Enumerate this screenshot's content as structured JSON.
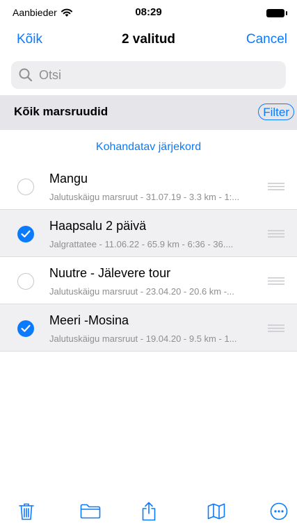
{
  "status": {
    "carrier": "Aanbieder",
    "time": "08:29"
  },
  "nav": {
    "left_label": "Kõik",
    "title": "2 valitud",
    "right_label": "Cancel"
  },
  "search": {
    "placeholder": "Otsi",
    "icon": "search-icon"
  },
  "section": {
    "title": "Kõik marsruudid",
    "filter_label": "Filter"
  },
  "sort_label": "Kohandatav järjekord",
  "routes": [
    {
      "title": "Mangu",
      "subtitle": "Jalutuskäigu marsruut - 31.07.19 - 3.3 km - 1:...",
      "selected": false
    },
    {
      "title": "Haapsalu 2 päivä",
      "subtitle": "Jalgrattatee - 11.06.22 - 65.9 km - 6:36 - 36....",
      "selected": true
    },
    {
      "title": "Nuutre - Jälevere tour",
      "subtitle": "Jalutuskäigu marsruut - 23.04.20 - 20.6 km -...",
      "selected": false
    },
    {
      "title": "Meeri -Mosina",
      "subtitle": "Jalutuskäigu marsruut - 19.04.20 - 9.5 km - 1...",
      "selected": true
    }
  ],
  "toolbar": {
    "icons": [
      "trash-icon",
      "folder-icon",
      "share-icon",
      "map-icon",
      "more-icon"
    ]
  },
  "colors": {
    "accent": "#0a7aff",
    "secondary_text": "#8e8e93",
    "section_bg": "#e5e5ea"
  }
}
